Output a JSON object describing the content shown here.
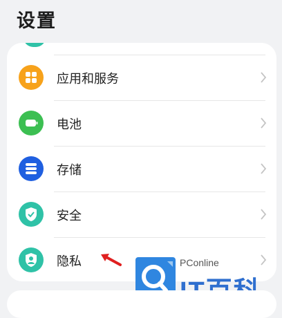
{
  "header": {
    "title": "设置"
  },
  "settings": {
    "items": [
      {
        "label": "应用和服务",
        "icon": "apps-grid-icon",
        "color": "#f7a21b"
      },
      {
        "label": "电池",
        "icon": "battery-icon",
        "color": "#3cbf52"
      },
      {
        "label": "存储",
        "icon": "storage-icon",
        "color": "#1f5fe0"
      },
      {
        "label": "安全",
        "icon": "shield-check-icon",
        "color": "#2fc2a7"
      },
      {
        "label": "隐私",
        "icon": "privacy-icon",
        "color": "#2fc2a7"
      }
    ]
  },
  "watermark": {
    "site": "PConline",
    "brand": "IT百科"
  },
  "colors": {
    "annotation_arrow": "#e02020",
    "chevron": "#c4c4c4",
    "brand": "#2f6fcf"
  }
}
